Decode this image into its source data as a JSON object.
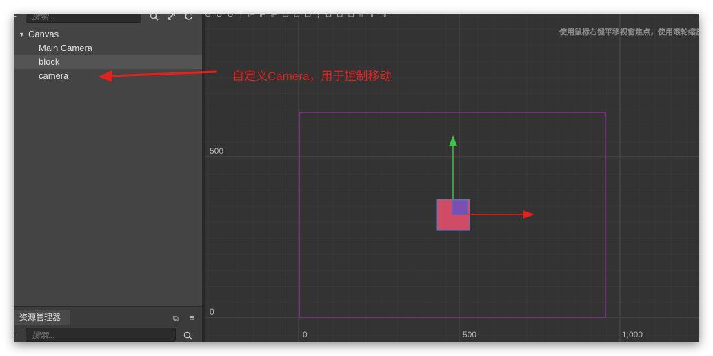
{
  "hierarchy": {
    "search_placeholder": "搜索...",
    "root_label": "Canvas",
    "nodes": [
      "Main Camera",
      "block",
      "camera"
    ]
  },
  "assets": {
    "tab_label": "资源管理器",
    "search_placeholder": "搜索..."
  },
  "scene": {
    "hint": "使用鼠标右键平移视窗焦点，使用滚轮缩放",
    "y_ticks": [
      "500",
      "0"
    ],
    "x_ticks": [
      "0",
      "500",
      "1,000"
    ]
  },
  "annotation": {
    "text": "自定义Camera，用于控制移动",
    "color": "#e0231f"
  },
  "colors": {
    "canvas_border": "#a93bb0",
    "block_fill": "#d04b66",
    "y_handle": "#3fc24a",
    "x_handle": "#e0231f"
  }
}
